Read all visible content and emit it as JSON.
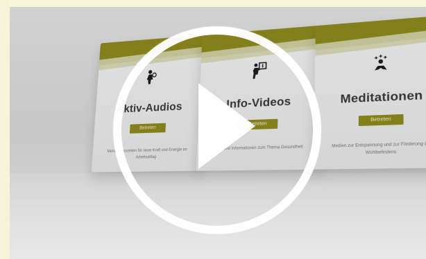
{
  "cards": [
    {
      "title": "Aktiv-Audios",
      "button_label": "Betreten",
      "description": "Mentale Auszeiten für neue Kraft und Energie im Arbeitsalltag",
      "icon": "person-icon"
    },
    {
      "title": "Info-Videos",
      "button_label": "Betreten",
      "description": "Tipps und Informationen zum Thema Gesundheit",
      "icon": "presentation-icon"
    },
    {
      "title": "Meditationen",
      "button_label": "Betreten",
      "description": "Medien zur Entspannung und zur Förderung des Wohlbefindens",
      "icon": "meditation-icon"
    }
  ],
  "play_icon": "play-icon",
  "colors": {
    "accent": "#8f8b1f",
    "background": "#fbfbe6",
    "card": "#f1f1f1"
  }
}
